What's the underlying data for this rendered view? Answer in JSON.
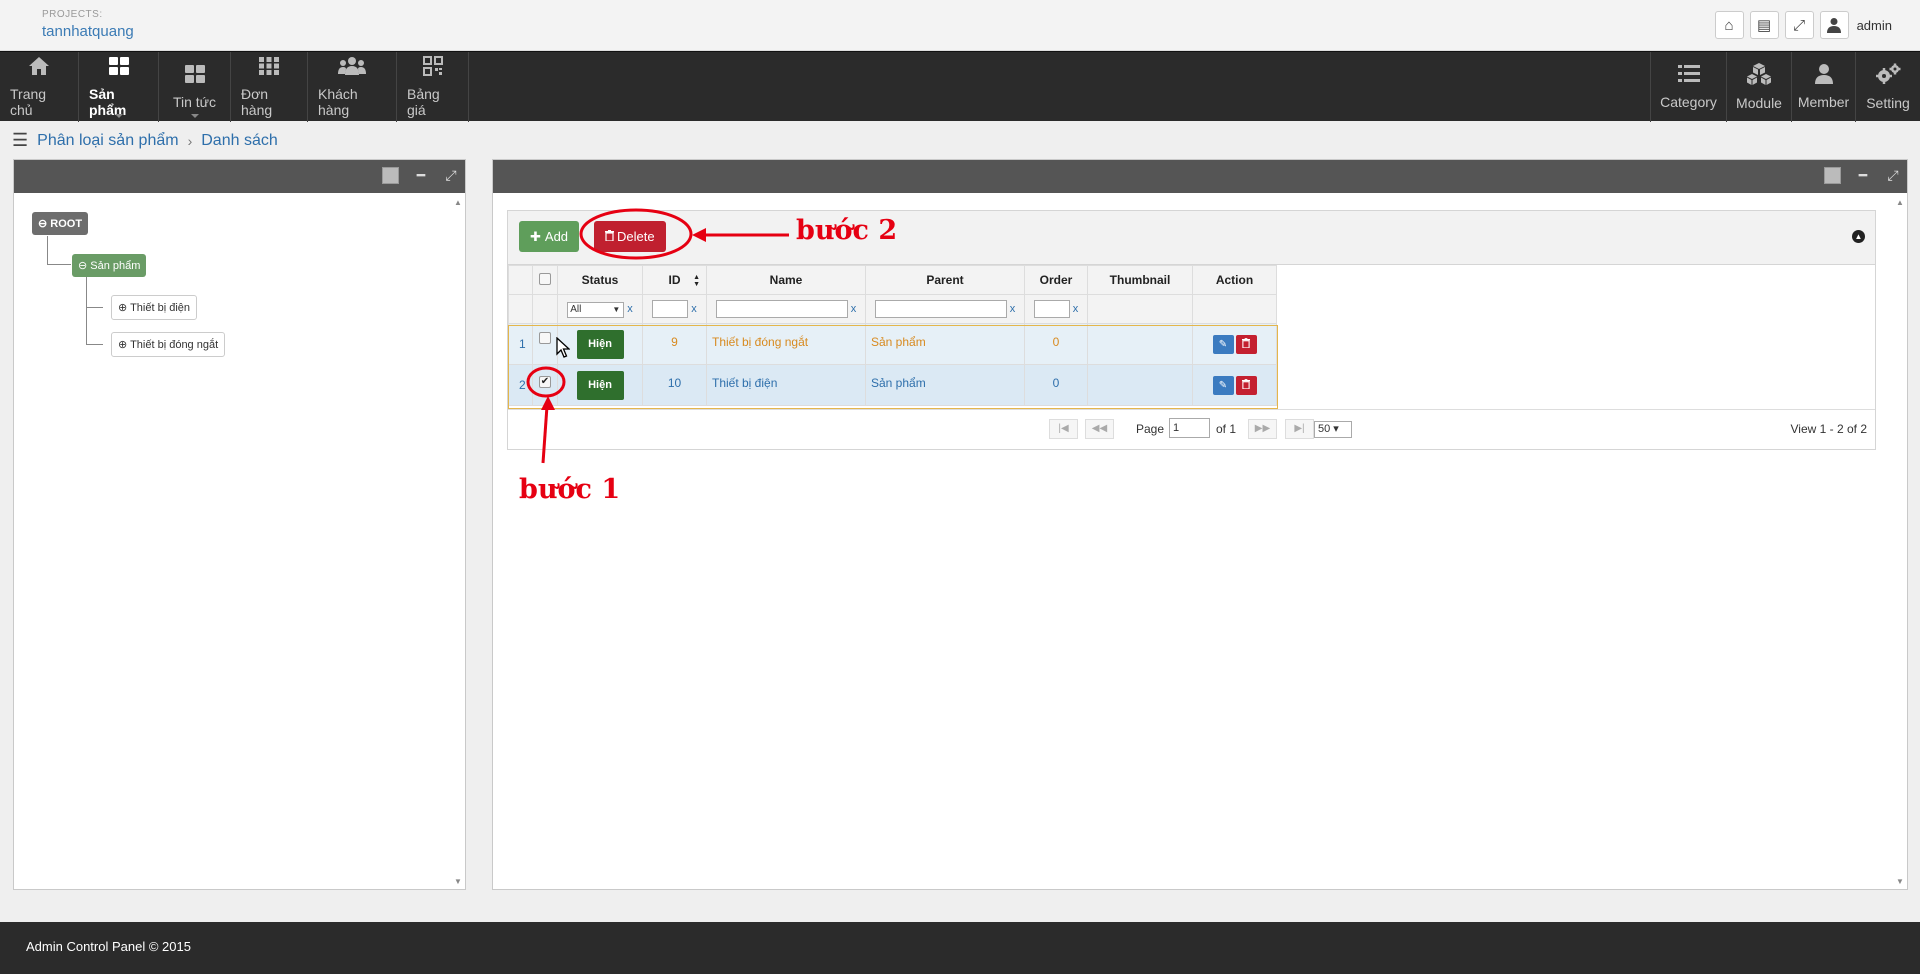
{
  "header": {
    "projects_label": "PROJECTS:",
    "project_name": "tannhatquang",
    "user": "admin"
  },
  "nav": {
    "left": [
      {
        "label": "Trang chủ",
        "icon": "home-icon"
      },
      {
        "label": "Sản phẩm",
        "icon": "grid-icon",
        "active": true
      },
      {
        "label": "Tin tức",
        "icon": "grid-icon"
      },
      {
        "label": "Đơn hàng",
        "icon": "apps-icon"
      },
      {
        "label": "Khách hàng",
        "icon": "users-icon"
      },
      {
        "label": "Bảng giá",
        "icon": "qrcode-icon"
      }
    ],
    "right": [
      {
        "label": "Category",
        "icon": "list-icon"
      },
      {
        "label": "Module",
        "icon": "cubes-icon"
      },
      {
        "label": "Member",
        "icon": "user-icon"
      },
      {
        "label": "Setting",
        "icon": "gears-icon"
      }
    ]
  },
  "breadcrumb": {
    "parent": "Phân loại sản phẩm",
    "current": "Danh sách"
  },
  "tree": {
    "root": "ROOT",
    "category": "Sản phẩm",
    "children": [
      "Thiết bị điện",
      "Thiết bị đóng ngắt"
    ]
  },
  "toolbar": {
    "add_label": "Add",
    "delete_label": "Delete"
  },
  "grid": {
    "columns": [
      "Status",
      "ID",
      "Name",
      "Parent",
      "Order",
      "Thumbnail",
      "Action"
    ],
    "status_filter": "All",
    "clear": "x",
    "rows": [
      {
        "num": "1",
        "checked": false,
        "status": "Hiện",
        "id": "9",
        "name": "Thiết bị đóng ngắt",
        "parent": "Sản phẩm",
        "order": "0"
      },
      {
        "num": "2",
        "checked": true,
        "status": "Hiện",
        "id": "10",
        "name": "Thiết bị điện",
        "parent": "Sản phẩm",
        "order": "0"
      }
    ]
  },
  "pager": {
    "page_label": "Page",
    "page": "1",
    "of_label": "of 1",
    "page_size": "50",
    "view_text": "View 1 - 2 of 2"
  },
  "annotations": {
    "step1": "bước 1",
    "step2": "bước 2"
  },
  "footer": {
    "text": "Admin Control Panel © 2015"
  },
  "colors": {
    "nav_bg": "#2b2b2b",
    "add_btn": "#5f9e5b",
    "delete_btn": "#c0202f",
    "status_btn": "#2f6f2d",
    "annotation": "#e60012",
    "link": "#2e6fab"
  }
}
